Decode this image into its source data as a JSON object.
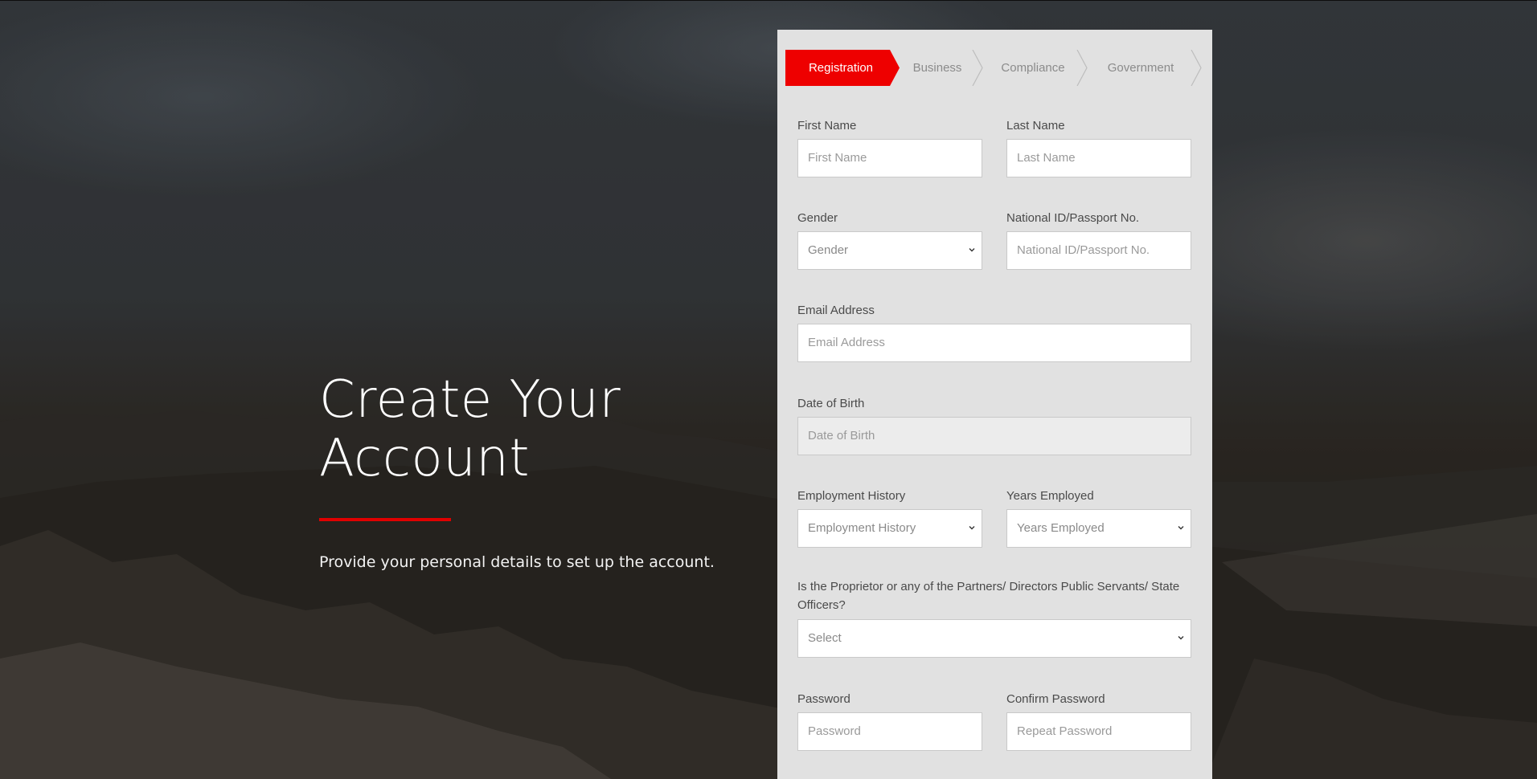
{
  "hero": {
    "title": "Create Your Account",
    "subtitle": "Provide your personal details to set up the account."
  },
  "steps": [
    {
      "label": "Registration",
      "active": true
    },
    {
      "label": "Business",
      "active": false
    },
    {
      "label": "Compliance",
      "active": false
    },
    {
      "label": "Government",
      "active": false
    }
  ],
  "colors": {
    "accent": "#ee0000",
    "panel": "#e1e1e1"
  },
  "form": {
    "first_name": {
      "label": "First Name",
      "placeholder": "First Name"
    },
    "last_name": {
      "label": "Last Name",
      "placeholder": "Last Name"
    },
    "gender": {
      "label": "Gender",
      "value": "Gender"
    },
    "national_id": {
      "label": "National ID/Passport No.",
      "placeholder": "National ID/Passport No."
    },
    "email": {
      "label": "Email Address",
      "placeholder": "Email Address"
    },
    "dob": {
      "label": "Date of Birth",
      "placeholder": "Date of Birth"
    },
    "employment_history": {
      "label": "Employment History",
      "value": "Employment History"
    },
    "years_employed": {
      "label": "Years Employed",
      "value": "Years Employed"
    },
    "public_servant": {
      "label": "Is the Proprietor or any of the Partners/ Directors Public Servants/ State Officers?",
      "value": "Select"
    },
    "password": {
      "label": "Password",
      "placeholder": "Password"
    },
    "confirm_password": {
      "label": "Confirm Password",
      "placeholder": "Repeat Password"
    }
  }
}
